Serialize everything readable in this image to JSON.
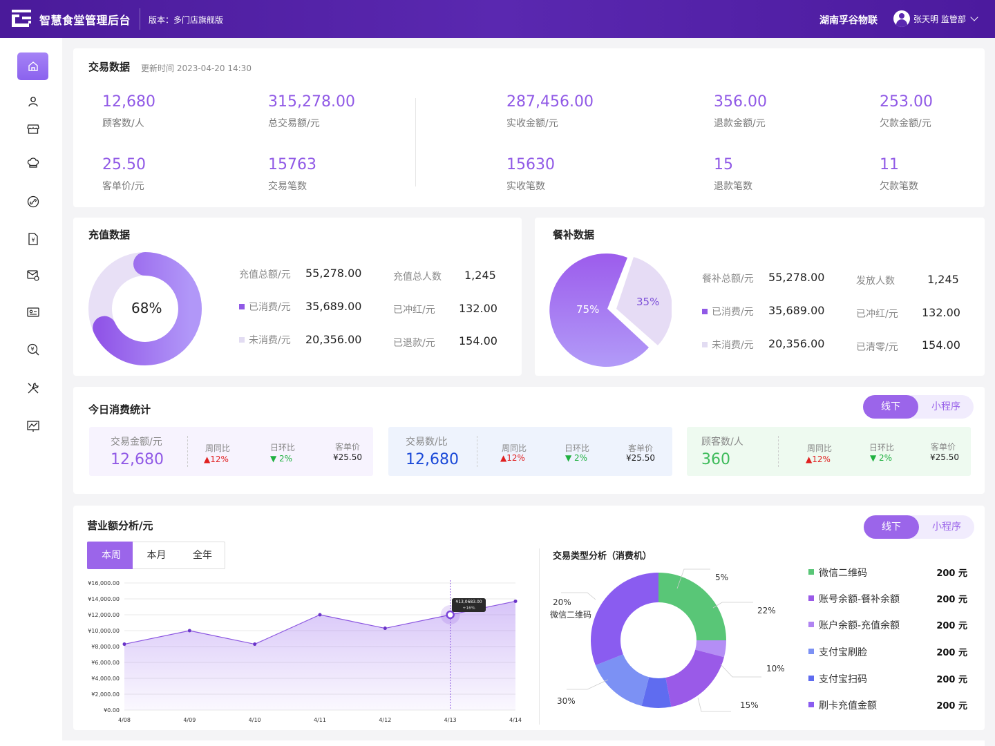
{
  "header": {
    "app_title": "智慧食堂管理后台",
    "version": "版本：多门店旗舰版",
    "company": "湖南孚谷物联",
    "user": "张天明 监管部",
    "brand_color": "#5a28b0"
  },
  "sidebar": {
    "items": [
      {
        "icon": "home-icon",
        "active": true
      },
      {
        "icon": "user-icon"
      },
      {
        "icon": "store-icon"
      },
      {
        "icon": "chef-hat-icon"
      },
      {
        "icon": "link-icon"
      },
      {
        "icon": "yuan-document-icon"
      },
      {
        "icon": "mail-icon"
      },
      {
        "icon": "id-card-icon"
      },
      {
        "icon": "yuan-search-icon"
      },
      {
        "icon": "tools-icon"
      },
      {
        "icon": "chart-icon"
      }
    ]
  },
  "transaction": {
    "title": "交易数据",
    "updated": "更新时间 2023-04-20 14:30",
    "kpis": [
      {
        "value": "12,680",
        "label": "顾客数/人"
      },
      {
        "value": "315,278.00",
        "label": "总交易额/元"
      },
      {
        "value": "287,456.00",
        "label": "实收金额/元"
      },
      {
        "value": "356.00",
        "label": "退款金额/元"
      },
      {
        "value": "253.00",
        "label": "欠款金额/元"
      },
      {
        "value": "25.50",
        "label": "客单价/元"
      },
      {
        "value": "15763",
        "label": "交易笔数"
      },
      {
        "value": "15630",
        "label": "实收笔数"
      },
      {
        "value": "15",
        "label": "退款笔数"
      },
      {
        "value": "11",
        "label": "欠款笔数"
      }
    ]
  },
  "recharge": {
    "title": "充值数据",
    "donut_center": "68%",
    "donut_percent": 68,
    "rows": [
      {
        "label": "充值总额/元",
        "value": "55,278.00"
      },
      {
        "label": "已消费/元",
        "value": "35,689.00"
      },
      {
        "label": "未消费/元",
        "value": "20,356.00"
      },
      {
        "label": "充值总人数",
        "value": "1,245"
      },
      {
        "label": "已冲红/元",
        "value": "132.00"
      },
      {
        "label": "已退款/元",
        "value": "154.00"
      }
    ]
  },
  "subsidy": {
    "title": "餐补数据",
    "pie_big": "75%",
    "pie_small": "35%",
    "rows": [
      {
        "label": "餐补总额/元",
        "value": "55,278.00"
      },
      {
        "label": "已消费/元",
        "value": "35,689.00"
      },
      {
        "label": "未消费/元",
        "value": "20,356.00"
      },
      {
        "label": "发放人数",
        "value": "1,245"
      },
      {
        "label": "已冲红/元",
        "value": "132.00"
      },
      {
        "label": "已清零/元",
        "value": "154.00"
      }
    ]
  },
  "today": {
    "title": "今日消费统计",
    "toggle": [
      "线下",
      "小程序"
    ],
    "stats": [
      {
        "title": "交易金额/元",
        "value": "12,680",
        "color": "#9059e6",
        "bg": "#f7f3fe",
        "wow_label": "周同比",
        "wow": "12%",
        "dod_label": "日环比",
        "dod": "2%",
        "avg_label": "客单价",
        "avg": "¥25.50"
      },
      {
        "title": "交易数/比",
        "value": "12,680",
        "color": "#1a49d8",
        "bg": "#eef3fd",
        "wow_label": "周同比",
        "wow": "12%",
        "dod_label": "日环比",
        "dod": "2%",
        "avg_label": "客单价",
        "avg": "¥25.50"
      },
      {
        "title": "顾客数/人",
        "value": "360",
        "color": "#3dbb5a",
        "bg": "#eefaf0",
        "wow_label": "周同比",
        "wow": "12%",
        "dod_label": "日环比",
        "dod": "2%",
        "avg_label": "客单价",
        "avg": "¥25.50"
      }
    ]
  },
  "revenue": {
    "title": "营业额分析/元",
    "toggle": [
      "线下",
      "小程序"
    ],
    "tabs": [
      "本周",
      "本月",
      "全年"
    ],
    "tooltip": "¥13,0683.00",
    "tooltip_sub": "+16%",
    "donut_title": "交易类型分析（消费机）",
    "donut_callouts": {
      "a": "5%",
      "b": "22%",
      "c": "10%",
      "d": "15%",
      "e": "30%",
      "f": "20%",
      "f_name": "微信二维码"
    },
    "legend": [
      {
        "name": "微信二维码",
        "amount": "200 元",
        "color": "#59c677"
      },
      {
        "name": "账号余额-餐补余额",
        "amount": "200 元",
        "color": "#9a5ae8"
      },
      {
        "name": "账户余额-充值余额",
        "amount": "200 元",
        "color": "#b084f2"
      },
      {
        "name": "支付宝刷脸",
        "amount": "200 元",
        "color": "#7c91f4"
      },
      {
        "name": "支付宝扫码",
        "amount": "200 元",
        "color": "#5f6cf0"
      },
      {
        "name": "刷卡充值金额",
        "amount": "200 元",
        "color": "#8a5cf0"
      }
    ]
  },
  "chart_data": {
    "type": "area",
    "x": [
      "4/08",
      "4/09",
      "4/10",
      "4/11",
      "4/12",
      "4/13",
      "4/14"
    ],
    "values": [
      8300,
      10000,
      8300,
      12000,
      10300,
      12000,
      13700
    ],
    "ylim": [
      0,
      16000
    ],
    "yticks": [
      "¥0.00",
      "¥2,000.00",
      "¥4,000.00",
      "¥6,000.00",
      "¥8,000.00",
      "¥10,000.00",
      "¥12,000.00",
      "¥14,000.00",
      "¥16,000.00"
    ],
    "highlight_index": 5,
    "color": "#8a54e0",
    "grid": true
  },
  "donut_data": {
    "type": "pie",
    "segments": [
      {
        "name": "微信二维码",
        "pct": 25,
        "color": "#59c677"
      },
      {
        "name": "账号余额-餐补余额",
        "pct": 4,
        "color": "#b48ef5"
      },
      {
        "name": "账户余额-充值余额",
        "pct": 18,
        "color": "#9a5ae8"
      },
      {
        "name": "支付宝扫码",
        "pct": 7,
        "color": "#5f6cf0"
      },
      {
        "name": "支付宝刷脸",
        "pct": 15,
        "color": "#7c91f4"
      },
      {
        "name": "刷卡充值金额",
        "pct": 31,
        "color": "#8a5cf0"
      }
    ]
  }
}
